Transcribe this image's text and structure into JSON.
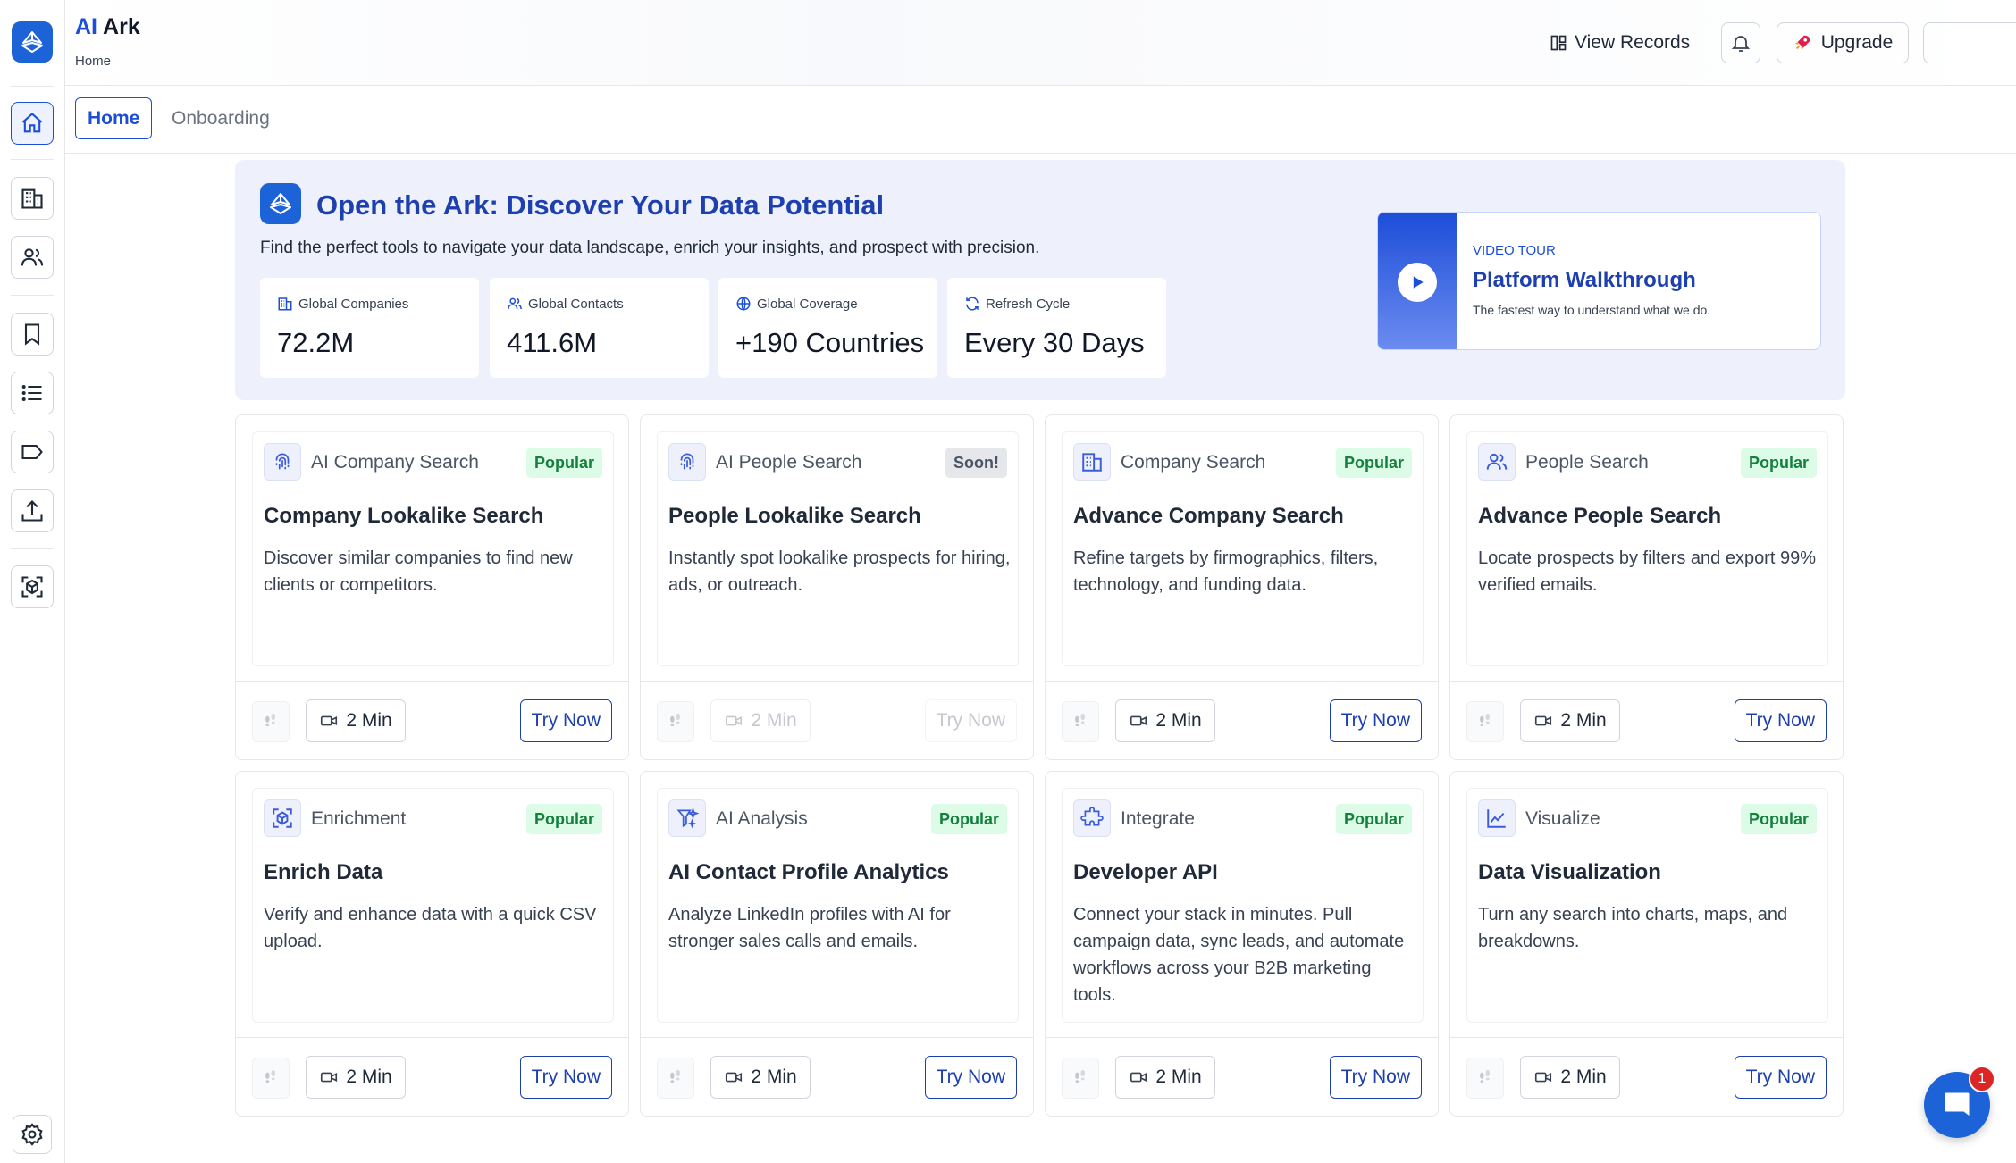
{
  "header": {
    "brand_ai": "AI",
    "brand_name": "Ark",
    "breadcrumb": "Home",
    "view_records": "View Records",
    "upgrade": "Upgrade"
  },
  "tabs": [
    {
      "label": "Home",
      "active": true
    },
    {
      "label": "Onboarding",
      "active": false
    }
  ],
  "hero": {
    "title": "Open the Ark: Discover Your Data Potential",
    "subtitle": "Find the perfect tools to navigate your data landscape, enrich your insights, and prospect with precision.",
    "stats": [
      {
        "label": "Global Companies",
        "value": "72.2M",
        "icon": "building-icon"
      },
      {
        "label": "Global Contacts",
        "value": "411.6M",
        "icon": "users-icon"
      },
      {
        "label": "Global Coverage",
        "value": "+190 Countries",
        "icon": "globe-icon"
      },
      {
        "label": "Refresh Cycle",
        "value": "Every 30 Days",
        "icon": "refresh-icon"
      }
    ],
    "video": {
      "tag": "VIDEO TOUR",
      "title": "Platform Walkthrough",
      "description": "The fastest way to understand what we do."
    }
  },
  "cards": [
    {
      "category": "AI Company Search",
      "badge": "Popular",
      "title": "Company Lookalike Search",
      "description": "Discover similar companies to find new clients or competitors.",
      "duration": "2 Min",
      "cta": "Try Now",
      "icon": "fingerprint-icon"
    },
    {
      "category": "AI People Search",
      "badge": "Soon!",
      "title": "People Lookalike Search",
      "description": "Instantly spot lookalike prospects for hiring, ads, or outreach.",
      "duration": "2 Min",
      "cta": "Try Now",
      "icon": "fingerprint-icon"
    },
    {
      "category": "Company Search",
      "badge": "Popular",
      "title": "Advance Company Search",
      "description": "Refine targets by firmographics, filters, technology, and funding data.",
      "duration": "2 Min",
      "cta": "Try Now",
      "icon": "building-icon"
    },
    {
      "category": "People Search",
      "badge": "Popular",
      "title": "Advance People Search",
      "description": "Locate prospects by filters and export 99% verified emails.",
      "duration": "2 Min",
      "cta": "Try Now",
      "icon": "users-icon"
    },
    {
      "category": "Enrichment",
      "badge": "Popular",
      "title": "Enrich Data",
      "description": "Verify and enhance data with a quick CSV upload.",
      "duration": "2 Min",
      "cta": "Try Now",
      "icon": "cube-scan-icon"
    },
    {
      "category": "AI Analysis",
      "badge": "Popular",
      "title": "AI Contact Profile Analytics",
      "description": "Analyze LinkedIn profiles with AI for stronger sales calls and emails.",
      "duration": "2 Min",
      "cta": "Try Now",
      "icon": "filter-sparkle-icon"
    },
    {
      "category": "Integrate",
      "badge": "Popular",
      "title": "Developer API",
      "description": "Connect your stack in minutes. Pull campaign data, sync leads, and automate workflows across your B2B marketing tools.",
      "duration": "2 Min",
      "cta": "Try Now",
      "icon": "puzzle-icon"
    },
    {
      "category": "Visualize",
      "badge": "Popular",
      "title": "Data Visualization",
      "description": "Turn any search into charts, maps, and breakdowns.",
      "duration": "2 Min",
      "cta": "Try Now",
      "icon": "line-chart-icon"
    }
  ],
  "chat": {
    "unread": "1"
  },
  "colors": {
    "accent": "#1d4ed8",
    "brand": "#1d63d8",
    "popular_bg": "#dcfce7",
    "popular_text": "#15803d",
    "hero_bg": "#eef1fb"
  }
}
